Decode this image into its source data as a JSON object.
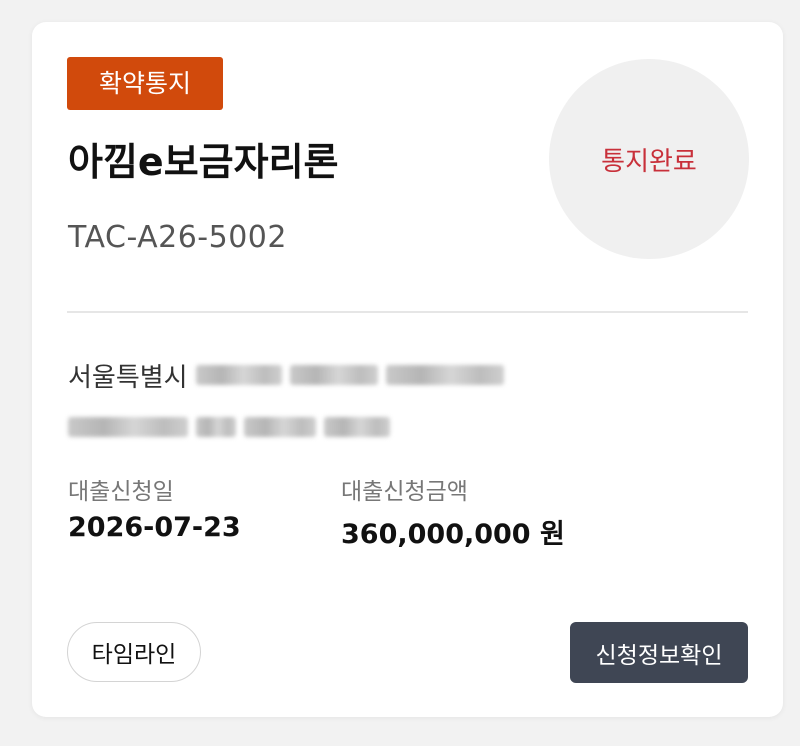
{
  "card": {
    "badge": "확약통지",
    "product_name": "아낌e보금자리론",
    "contract_id": "TAC-A26-5002",
    "status": "통지완료",
    "address_visible": "서울특별시 ",
    "address_redacted": true,
    "fields": {
      "apply_date_label": "대출신청일",
      "apply_date_value": "2026-07-23",
      "amount_label": "대출신청금액",
      "amount_value": "360,000,000 원"
    },
    "buttons": {
      "timeline": "타임라인",
      "view_info": "신청정보확인"
    }
  },
  "colors": {
    "badge_bg": "#d14a0c",
    "status_text": "#c8303a",
    "primary_button": "#3f4654"
  }
}
